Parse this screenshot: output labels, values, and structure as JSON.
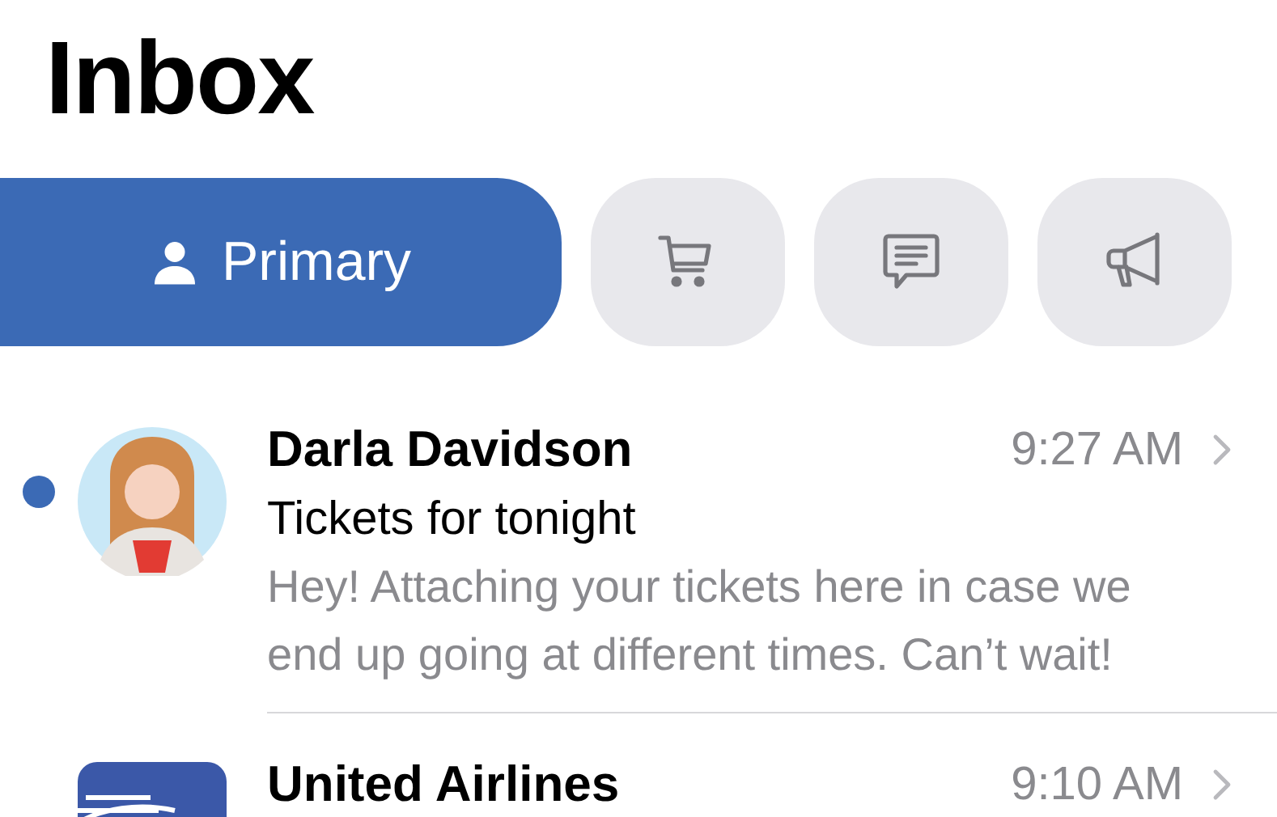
{
  "title": "Inbox",
  "tabs": [
    {
      "kind": "label",
      "label": "Primary",
      "selected": true
    },
    {
      "kind": "cart",
      "selected": false
    },
    {
      "kind": "chat",
      "selected": false
    },
    {
      "kind": "megaphone",
      "selected": false
    }
  ],
  "messages": [
    {
      "kind": "memoji",
      "unread": true,
      "sender": "Darla Davidson",
      "time": "9:27 AM",
      "subject": "Tickets for tonight",
      "preview": "Hey! Attaching your tickets here in case we end up going at different times. Can’t wait!"
    },
    {
      "kind": "logo",
      "unread": false,
      "sender": "United Airlines",
      "time": "9:10 AM"
    }
  ]
}
